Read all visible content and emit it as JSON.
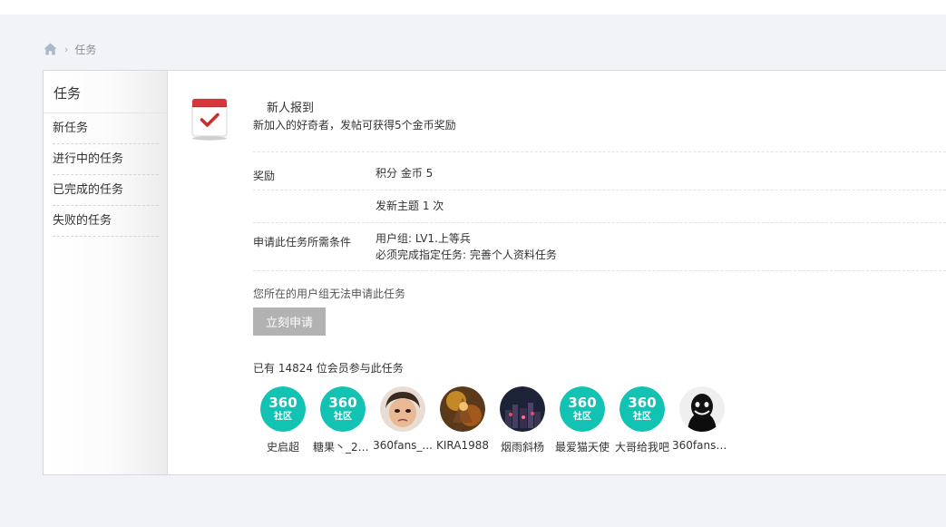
{
  "breadcrumb": {
    "home_icon": "home-icon",
    "current": "任务"
  },
  "sidebar": {
    "title": "任务",
    "items": [
      {
        "label": "新任务"
      },
      {
        "label": "进行中的任务"
      },
      {
        "label": "已完成的任务"
      },
      {
        "label": "失败的任务"
      }
    ]
  },
  "task": {
    "icon": "calendar-check-icon",
    "name": "新人报到",
    "description": "新加入的好奇者，发帖可获得5个金币奖励",
    "reward_label": "奖励",
    "reward_value": "积分 金币 5",
    "action_value": "发新主题 1 次",
    "requirement_label": "申请此任务所需条件",
    "requirement_group": "用户组: LV1.上等兵",
    "requirement_prereq": "必须完成指定任务: 完善个人资料任务",
    "notice": "您所在的用户组无法申请此任务",
    "apply_button": "立刻申请",
    "participants_text": "已有 14824 位会员参与此任务"
  },
  "members": [
    {
      "name": "史启超",
      "avatar": "360-logo"
    },
    {
      "name": "糖果丶_20...",
      "avatar": "360-logo"
    },
    {
      "name": "360fans_...",
      "avatar": "baby-face-photo"
    },
    {
      "name": "KIRA1988",
      "avatar": "warrior-art"
    },
    {
      "name": "烟雨斜杨",
      "avatar": "night-city-photo"
    },
    {
      "name": "最爱猫天使",
      "avatar": "360-logo"
    },
    {
      "name": "大哥给我吧",
      "avatar": "360-logo"
    },
    {
      "name": "360fans3...",
      "avatar": "dark-grin-face"
    }
  ],
  "colors": {
    "page_bg": "#f2f3f7",
    "logo_teal": "#12c3b3",
    "icon_red": "#d8343a",
    "button_gray": "#b2b2b2"
  }
}
